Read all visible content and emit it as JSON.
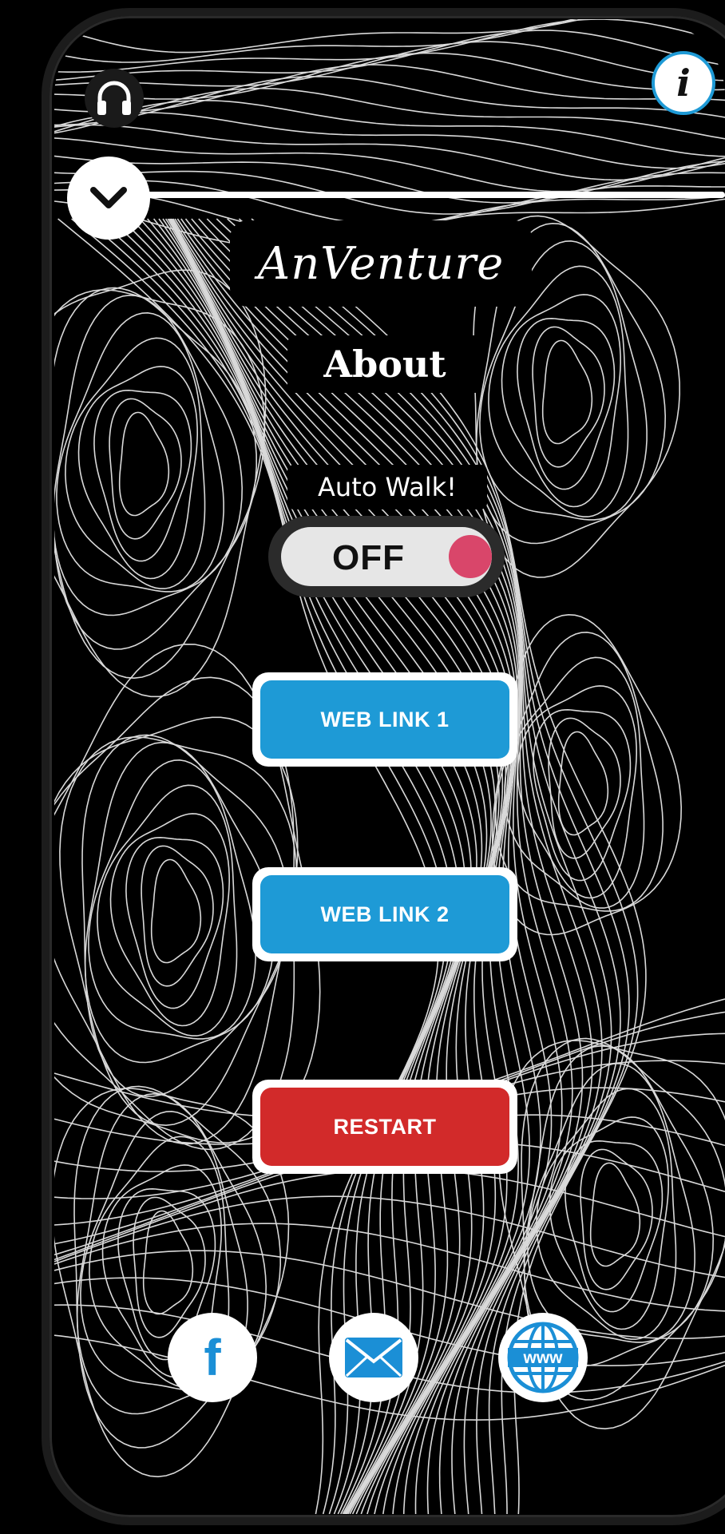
{
  "app": {
    "logo_text": "AnVenture",
    "page_title": "About"
  },
  "header": {
    "audio_icon": "headphones-icon",
    "info_icon": "info-icon",
    "info_glyph": "i",
    "collapse_icon": "chevron-down-icon"
  },
  "auto_walk": {
    "label": "Auto Walk!",
    "state_text": "OFF",
    "is_on": false
  },
  "buttons": {
    "web_link_1": "WEB LINK 1",
    "web_link_2": "WEB LINK 2",
    "restart": "RESTART"
  },
  "social": {
    "facebook_glyph": "f",
    "facebook_icon": "facebook-icon",
    "mail_icon": "mail-icon",
    "web_label": "www",
    "web_icon": "globe-icon"
  },
  "colors": {
    "link_blue": "#1e9ad6",
    "restart_red": "#d22a2a",
    "toggle_knob": "#d9466a",
    "background": "#000000",
    "contour": "#ffffff"
  }
}
